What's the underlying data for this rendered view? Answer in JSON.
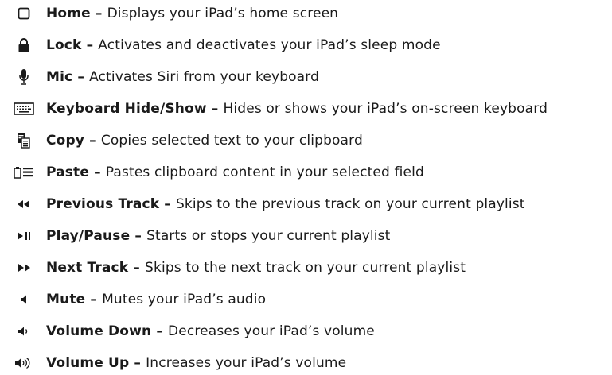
{
  "items": [
    {
      "icon": "home-icon",
      "name": "Home",
      "sep": " – ",
      "desc": "Displays your iPad’s home screen"
    },
    {
      "icon": "lock-icon",
      "name": "Lock",
      "sep": " – ",
      "desc": "Activates and deactivates your iPad’s sleep mode"
    },
    {
      "icon": "mic-icon",
      "name": "Mic",
      "sep": " – ",
      "desc": "Activates Siri from your keyboard"
    },
    {
      "icon": "keyboard-icon",
      "name": "Keyboard Hide/Show",
      "sep": " – ",
      "desc": "Hides or shows your iPad’s on-screen keyboard"
    },
    {
      "icon": "copy-icon",
      "name": "Copy",
      "sep": " – ",
      "desc": "Copies selected text to your clipboard"
    },
    {
      "icon": "paste-icon",
      "name": "Paste",
      "sep": " – ",
      "desc": "Pastes clipboard content in your selected field"
    },
    {
      "icon": "previous-track-icon",
      "name": "Previous Track",
      "sep": " – ",
      "desc": "Skips to the previous track on your current playlist"
    },
    {
      "icon": "play-pause-icon",
      "name": "Play/Pause",
      "sep": " – ",
      "desc": "Starts or stops your current playlist"
    },
    {
      "icon": "next-track-icon",
      "name": "Next Track",
      "sep": " – ",
      "desc": "Skips to the next track on your current playlist"
    },
    {
      "icon": "mute-icon",
      "name": "Mute",
      "sep": " – ",
      "desc": "Mutes your iPad’s audio"
    },
    {
      "icon": "volume-down-icon",
      "name": "Volume Down",
      "sep": " – ",
      "desc": "Decreases your iPad’s volume"
    },
    {
      "icon": "volume-up-icon",
      "name": "Volume Up",
      "sep": " – ",
      "desc": "Increases your iPad’s volume"
    }
  ]
}
